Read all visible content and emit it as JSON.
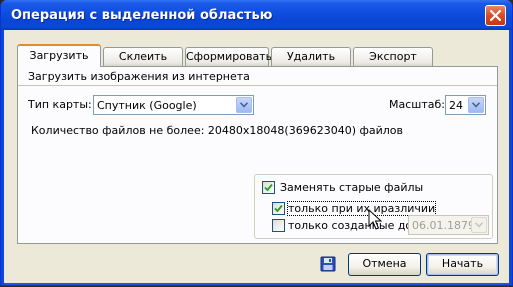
{
  "window": {
    "title": "Операция с выделенной областью"
  },
  "tabs": [
    {
      "label": "Загрузить",
      "active": true
    },
    {
      "label": "Склеить",
      "active": false
    },
    {
      "label": "Сформировать",
      "active": false
    },
    {
      "label": "Удалить",
      "active": false
    },
    {
      "label": "Экспорт",
      "active": false
    }
  ],
  "panel": {
    "section_title": "Загрузить изображения из интернета",
    "map_type_label": "Тип карты:",
    "map_type_value": "Спутник (Google)",
    "zoom_label": "Масштаб:",
    "zoom_value": "24",
    "files_info": "Количество файлов не более: 20480x18048(369623040) файлов",
    "replace_old": {
      "label": "Заменять старые файлы",
      "checked": true
    },
    "only_different": {
      "label": "только при их иразличии",
      "checked": true
    },
    "only_created": {
      "label": "только созданные до",
      "checked": false
    },
    "date_value": "06.01.1879"
  },
  "buttons": {
    "cancel": "Отмена",
    "start": "Начать"
  },
  "icons": {
    "close": "close-icon",
    "save": "floppy-disk-icon",
    "cursor": "mouse-cursor-icon"
  },
  "colors": {
    "titlebar": "#0a46d6",
    "tab_highlight": "#e68b2c",
    "close_button": "#d94b25"
  }
}
